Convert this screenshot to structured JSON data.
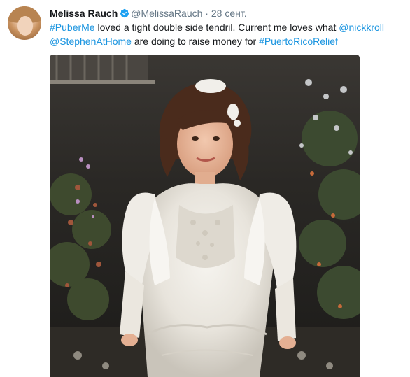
{
  "author": {
    "name": "Melissa Rauch",
    "handle": "@MelissaRauch",
    "separator": "·",
    "date": "28 сент.",
    "verified": true,
    "avatar_icon": "profile-photo"
  },
  "tweet": {
    "segments": [
      {
        "text": "#PuberMe",
        "type": "hashtag"
      },
      {
        "text": " loved a tight double side tendril. Current me loves what ",
        "type": "text"
      },
      {
        "text": "@nickkroll",
        "type": "mention"
      },
      {
        "text": " ",
        "type": "text"
      },
      {
        "text": "@StephenAtHome",
        "type": "mention"
      },
      {
        "text": " are doing to raise money for ",
        "type": "text"
      },
      {
        "text": "#PuertoRicoRelief",
        "type": "hashtag"
      }
    ]
  },
  "media": {
    "type": "photo"
  },
  "colors": {
    "link": "#1b95e0",
    "verified": "#1da1f2",
    "secondary": "#657786"
  }
}
